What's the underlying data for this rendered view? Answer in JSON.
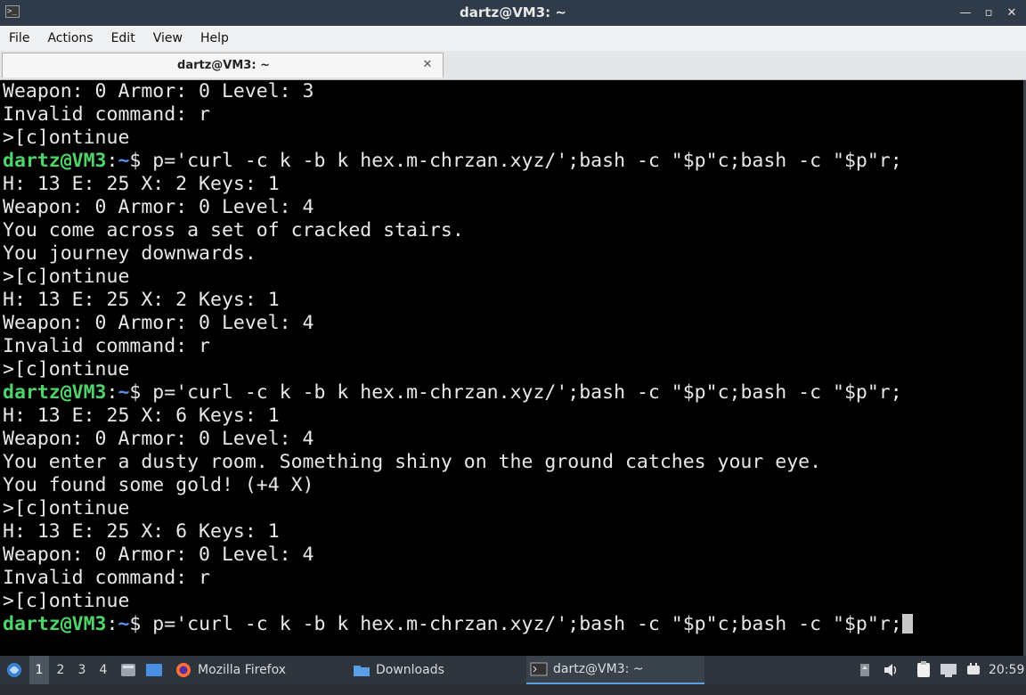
{
  "window": {
    "title": "dartz@VM3: ~",
    "icon": "terminal-icon",
    "controls": [
      "minimize-icon",
      "restore-icon",
      "close-icon"
    ]
  },
  "menu": [
    "File",
    "Actions",
    "Edit",
    "View",
    "Help"
  ],
  "tab": {
    "label": "dartz@VM3: ~",
    "close_icon": "close-icon"
  },
  "prompt": {
    "user": "dartz@VM3",
    "sep": ":",
    "path": "~",
    "dollar": "$"
  },
  "terminal_lines": [
    {
      "type": "out",
      "text": "Weapon: 0 Armor: 0 Level: 3"
    },
    {
      "type": "out",
      "text": "Invalid command: r"
    },
    {
      "type": "out",
      "text": ">[c]ontinue"
    },
    {
      "type": "cmd",
      "text": " p='curl -c k -b k hex.m-chrzan.xyz/';bash -c \"$p\"c;bash -c \"$p\"r;"
    },
    {
      "type": "out",
      "text": "H: 13 E: 25 X: 2 Keys: 1"
    },
    {
      "type": "out",
      "text": "Weapon: 0 Armor: 0 Level: 4"
    },
    {
      "type": "out",
      "text": "You come across a set of cracked stairs."
    },
    {
      "type": "out",
      "text": "You journey downwards."
    },
    {
      "type": "out",
      "text": ">[c]ontinue"
    },
    {
      "type": "out",
      "text": "H: 13 E: 25 X: 2 Keys: 1"
    },
    {
      "type": "out",
      "text": "Weapon: 0 Armor: 0 Level: 4"
    },
    {
      "type": "out",
      "text": "Invalid command: r"
    },
    {
      "type": "out",
      "text": ">[c]ontinue"
    },
    {
      "type": "cmd",
      "text": " p='curl -c k -b k hex.m-chrzan.xyz/';bash -c \"$p\"c;bash -c \"$p\"r;"
    },
    {
      "type": "out",
      "text": "H: 13 E: 25 X: 6 Keys: 1"
    },
    {
      "type": "out",
      "text": "Weapon: 0 Armor: 0 Level: 4"
    },
    {
      "type": "out",
      "text": "You enter a dusty room. Something shiny on the ground catches your eye."
    },
    {
      "type": "out",
      "text": "You found some gold! (+4 X)"
    },
    {
      "type": "out",
      "text": ">[c]ontinue"
    },
    {
      "type": "out",
      "text": "H: 13 E: 25 X: 6 Keys: 1"
    },
    {
      "type": "out",
      "text": "Weapon: 0 Armor: 0 Level: 4"
    },
    {
      "type": "out",
      "text": "Invalid command: r"
    },
    {
      "type": "out",
      "text": ">[c]ontinue"
    },
    {
      "type": "cmd",
      "text": " p='curl -c k -b k hex.m-chrzan.xyz/';bash -c \"$p\"c;bash -c \"$p\"r;",
      "cursor": true
    }
  ],
  "colors": {
    "prompt_user": "#4fd36b",
    "prompt_path": "#5b8fe8",
    "terminal_bg": "#000000",
    "terminal_fg": "#e8e8e8"
  },
  "taskbar": {
    "start_icon": "start-menu-icon",
    "workspaces": [
      "1",
      "2",
      "3",
      "4"
    ],
    "active_workspace": "1",
    "launchers": [
      "file-manager-icon",
      "show-desktop-icon"
    ],
    "windows": [
      {
        "label": "Mozilla Firefox",
        "icon": "firefox-icon"
      },
      {
        "label": "Downloads",
        "icon": "folder-icon"
      },
      {
        "label": "dartz@VM3: ~",
        "icon": "terminal-icon",
        "active": true
      }
    ],
    "tray": [
      "upload-icon",
      "volume-icon",
      "clipboard-icon",
      "network-icon",
      "power-icon"
    ],
    "clock": "20:59"
  }
}
